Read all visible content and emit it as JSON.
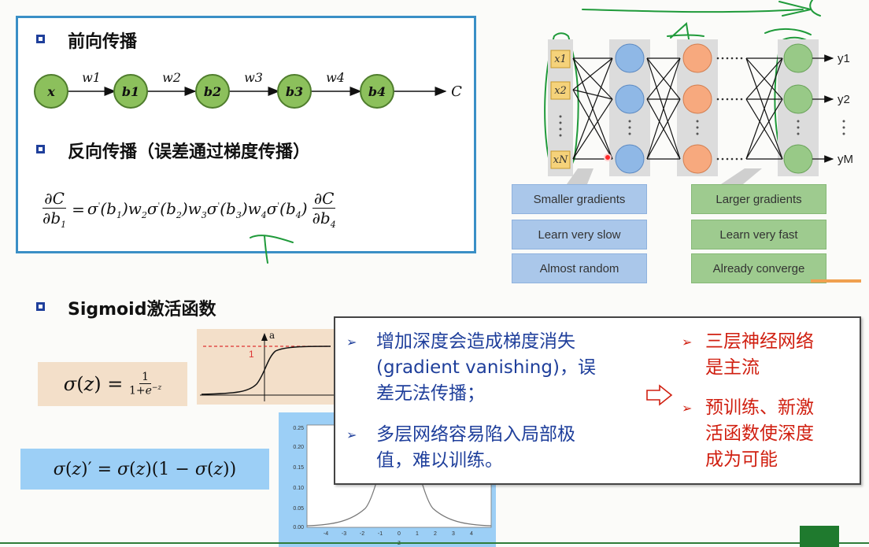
{
  "sections": {
    "forward_title": "前向传播",
    "backward_title": "反向传播（误差通过梯度传播）",
    "sigmoid_title": "Sigmoid激活函数"
  },
  "chain": {
    "nodes": [
      "x",
      "b1",
      "b2",
      "b3",
      "b4"
    ],
    "weights": [
      "w1",
      "w2",
      "w3",
      "w4"
    ],
    "end": "C"
  },
  "network": {
    "inputs": [
      "x1",
      "x2",
      "xN"
    ],
    "outputs": [
      "y1",
      "y2",
      "yM"
    ],
    "left_labels": [
      "Smaller gradients",
      "Learn very slow",
      "Almost random"
    ],
    "right_labels": [
      "Larger gradients",
      "Learn very fast",
      "Already converge"
    ]
  },
  "sigmoid_plot": {
    "y_label": "a",
    "level_label": "1"
  },
  "deriv_plot": {
    "y_ticks": [
      "0.25",
      "0.20",
      "0.15",
      "0.10",
      "0.05",
      "0.00"
    ],
    "x_ticks": [
      "-4",
      "-3",
      "-2",
      "-1",
      "0",
      "1",
      "2",
      "3",
      "4"
    ],
    "x_label": "z"
  },
  "callout": {
    "left": [
      {
        "lines": [
          "增加深度会造成梯度消失",
          "(gradient vanishing)，误",
          "差无法传播；"
        ]
      },
      {
        "lines": [
          "多层网络容易陷入局部极",
          "值，难以训练。"
        ]
      }
    ],
    "right": [
      {
        "lines": [
          "三层神经网络",
          "是主流"
        ]
      },
      {
        "lines": [
          "预训练、新激",
          "活函数使深度",
          "成为可能"
        ]
      }
    ]
  },
  "colors": {
    "node_green": "#8cc05c",
    "frame_blue": "#3a8fc6",
    "callout_blue": "#1f3f9b",
    "callout_red": "#d01f10",
    "sigmoid_bg": "#f3dfc9",
    "deriv_bg": "#9ccff6"
  }
}
